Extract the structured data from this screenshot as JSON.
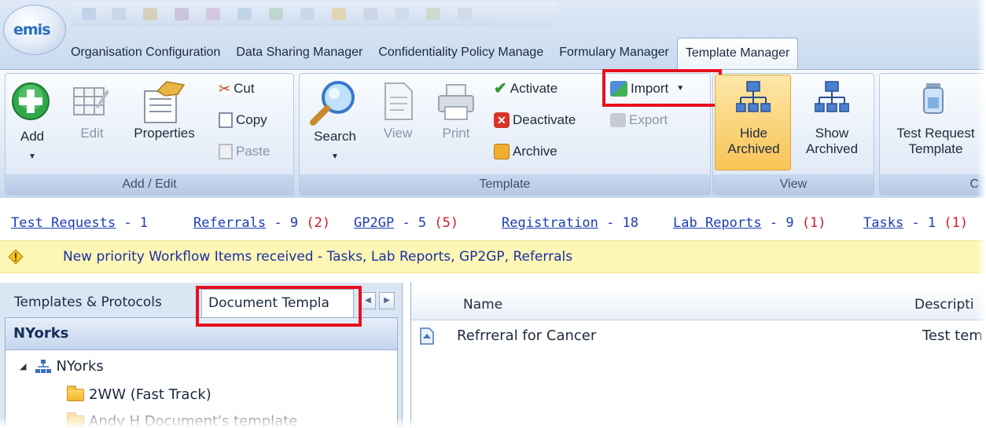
{
  "app": {
    "orb_label": "emis"
  },
  "tabs": [
    {
      "label": "Organisation Configuration",
      "active": false
    },
    {
      "label": "Data Sharing Manager",
      "active": false
    },
    {
      "label": "Confidentiality Policy Manage",
      "active": false
    },
    {
      "label": "Formulary Manager",
      "active": false
    },
    {
      "label": "Template Manager",
      "active": true
    }
  ],
  "ribbon": {
    "add_edit": {
      "label": "Add / Edit",
      "add": "Add",
      "edit": "Edit",
      "properties": "Properties",
      "cut": "Cut",
      "copy": "Copy",
      "paste": "Paste"
    },
    "template": {
      "label": "Template",
      "search": "Search",
      "view": "View",
      "print": "Print",
      "activate": "Activate",
      "deactivate": "Deactivate",
      "archive": "Archive",
      "import": "Import",
      "export": "Export"
    },
    "view": {
      "label": "View",
      "hide_archived_1": "Hide",
      "hide_archived_2": "Archived",
      "show_archived_1": "Show",
      "show_archived_2": "Archived"
    },
    "other": {
      "test_request_1": "Test Request",
      "test_request_2": "Template",
      "label_partial": "C"
    }
  },
  "workflow": [
    {
      "name": "Test Requests",
      "count": "- 1",
      "priority": ""
    },
    {
      "name": "Referrals",
      "count": "- 9",
      "priority": "(2)"
    },
    {
      "name": "GP2GP",
      "count": "- 5",
      "priority": "(5)"
    },
    {
      "name": "Registration",
      "count": "- 18",
      "priority": ""
    },
    {
      "name": "Lab Reports",
      "count": "- 9",
      "priority": "(1)"
    },
    {
      "name": "Tasks",
      "count": "- 1",
      "priority": "(1)"
    }
  ],
  "notice": "New priority Workflow Items received - Tasks, Lab Reports, GP2GP, Referrals",
  "left_panel": {
    "tab_inactive": "Templates & Protocols",
    "tab_active": "Document Templa",
    "tree_header": "NYorks",
    "tree": [
      {
        "label": "NYorks"
      },
      {
        "label": "2WW (Fast Track)"
      },
      {
        "label": "Andy H Document's template"
      }
    ]
  },
  "right_panel": {
    "columns": [
      "Name",
      "Descripti"
    ],
    "rows": [
      {
        "name": "Refrreral for Cancer",
        "description": "Test tem"
      }
    ]
  },
  "colors": {
    "highlight": "#e8101f",
    "link": "#1d3db5",
    "priority": "#d0182b",
    "notice_bg": "#fdf6b4"
  }
}
